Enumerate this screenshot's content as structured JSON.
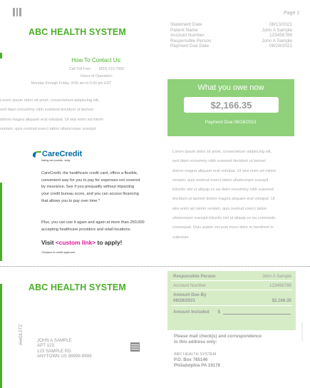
{
  "header": {
    "page": "Page 1",
    "company": "ABC HEALTH SYSTEM"
  },
  "statement": {
    "rows": [
      {
        "label": "Statement Date",
        "value": "08/13/2021"
      },
      {
        "label": "Patient Name",
        "value": "John A Sample"
      },
      {
        "label": "Account Number",
        "value": "123456789"
      },
      {
        "label": "Responsible Person",
        "value": "John A Sample"
      },
      {
        "label": "Payment Due Date",
        "value": "08/28/2021"
      }
    ]
  },
  "contact": {
    "title": "How To Contact Us:",
    "toll_free_label": "Call Toll Free",
    "toll_free_number": "(833) 210-7960",
    "hours_label": "Hours of Operation:",
    "hours": "Monday through Friday: 8:00 am to 6:00 pm EST"
  },
  "lorem_left": [
    "Lorem ipsum dolor sit amet, consectetuer adipiscing elit,",
    "sed diam nonummy nibh euismod tincidunt ut laoreet",
    "dolore magna aliquam erat volutpat. Ut wisi enim ad minim",
    "veniam, quis nostrud exerci tation ullamcorper suscipit"
  ],
  "owe": {
    "title": "What you owe now",
    "amount": "$2,166.35",
    "due": "Payment Due 08/28/2021"
  },
  "lorem_right": [
    "Lorem ipsum dolor sit amet, consectetuer adipiscing elit,",
    "sed diam nonummy nibh euismod tincidunt ut laoreet",
    "dolore magna aliquam erat volutpat. Ut wisi enim ad minim",
    "veniam, quis nostrud exerci tation ullamcorper suscipit",
    "lobortis nisl ut aliquip ex ea diam nonummy nibh euismod",
    "tincidunt ut laoreet dolore magna aliquam erat volutpat. Ut",
    "wisi enim ad minim veniam, quis nostrud exerci tation",
    "ullamcorper suscipit lobortis nisl ut aliquip ex ea commodo",
    "consequat. Duis autem vel eum iriure dolor in hendrerit in",
    "vulputate"
  ],
  "carecredit": {
    "logo": "CareCredit",
    "tagline": "Making care possible...today.",
    "para1": [
      "CareCredit, the healthcare credit card, offers a flexible,",
      "convenient way for you to pay for expenses not covered",
      "by insurance. See if you prequalify without impacting",
      "your credit bureau score, and you can access financing",
      "that allows you to pay over time.*"
    ],
    "para2": [
      "Plus, you can use it again and again at more than 250,000",
      "accepting healthcare providers and retail locations."
    ],
    "visit_prefix": "Visit ",
    "visit_link": "<custom link>",
    "visit_suffix": " to apply!",
    "subject": "*Subject to credit approval."
  },
  "remit": {
    "responsible_label": "Responsible Person",
    "responsible_value": "John A Sample",
    "account_label": "Account Number",
    "account_value": "123456789",
    "amount_due_label": "Amount Due By",
    "amount_due_date": "08/28/2021",
    "amount_due_value": "$2,166.35",
    "amount_included_label": "Amount Included",
    "currency": "$"
  },
  "mail": {
    "heading_1": "Please mail check(s) and correspondence",
    "heading_2": "to this address only:",
    "name": "ABC HEALTH SYSTEM",
    "po": "P.O. Box 785146",
    "city": "Philadelphia PA 19178"
  },
  "patient_address": {
    "line1": "JOHN A SAMPLE",
    "line2": "APT 123",
    "line3": "123 SAMPLE RD",
    "line4": "ANYTOWN US 99999-9999"
  },
  "vertical_code": "###DL5TZ",
  "vertical_right": "AAAAAAAA_NNNN"
}
